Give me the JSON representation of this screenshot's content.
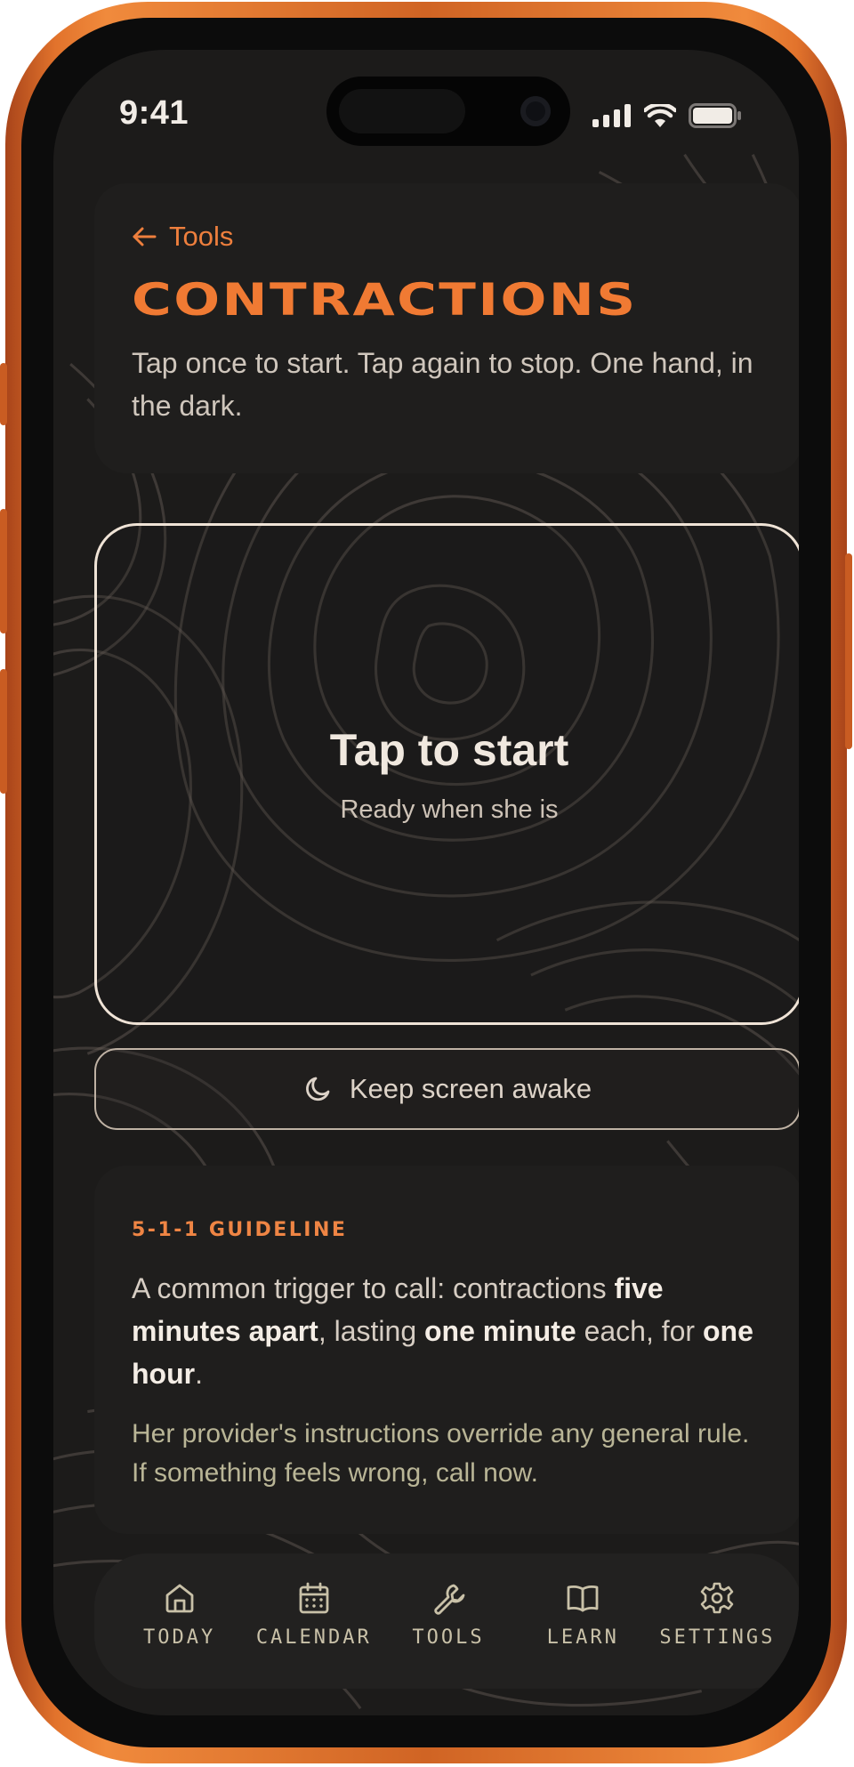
{
  "status_bar": {
    "time": "9:41"
  },
  "header": {
    "back_label": "Tools",
    "title": "CONTRACTIONS",
    "subtitle": "Tap once to start. Tap again to stop. One hand, in the dark."
  },
  "timer": {
    "title": "Tap to start",
    "subtitle": "Ready when she is"
  },
  "keep_awake": {
    "label": "Keep screen awake",
    "icon": "moon-icon"
  },
  "guideline": {
    "label": "5-1-1 GUIDELINE",
    "text_1": "A common trigger to call: contractions ",
    "bold_1": "five minutes apart",
    "text_2": ", lasting ",
    "bold_2": "one minute",
    "text_3": " each, for ",
    "bold_3": "one hour",
    "text_4": ".",
    "note": "Her provider's instructions override any general rule. If something feels wrong, call now."
  },
  "tabs": [
    {
      "label": "TODAY",
      "icon": "home-icon"
    },
    {
      "label": "CALENDAR",
      "icon": "calendar-icon"
    },
    {
      "label": "TOOLS",
      "icon": "wrench-icon"
    },
    {
      "label": "LEARN",
      "icon": "book-icon"
    },
    {
      "label": "SETTINGS",
      "icon": "gear-icon"
    }
  ],
  "colors": {
    "accent": "#f07a33",
    "background": "#1c1b1a",
    "card": "#1f1e1d",
    "text": "#d6cdc3",
    "frame": "#e2732c"
  }
}
